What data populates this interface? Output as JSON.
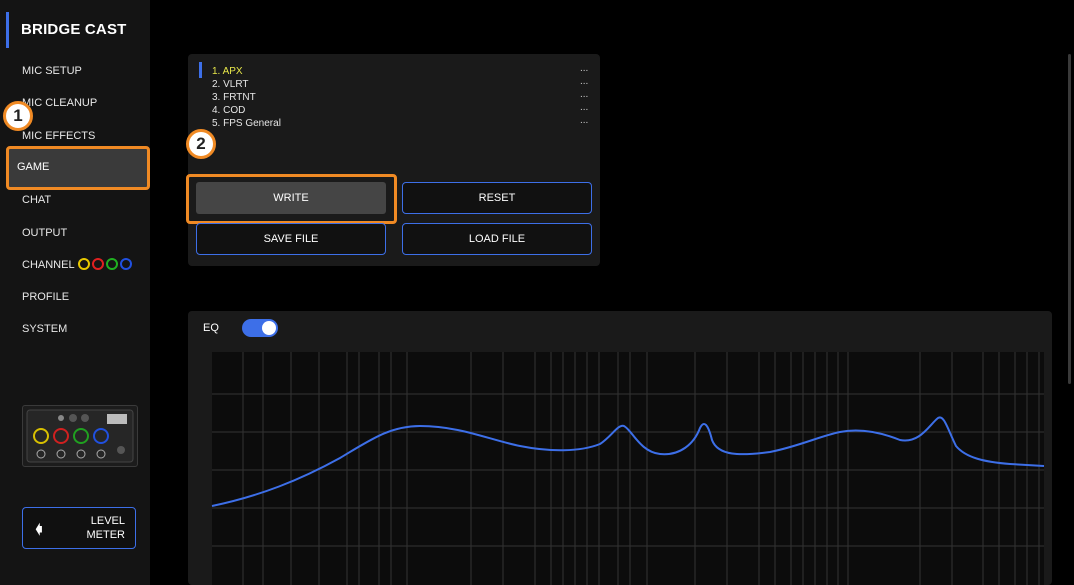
{
  "sidebar": {
    "brand": "BRIDGE CAST",
    "items": [
      {
        "label": "MIC SETUP"
      },
      {
        "label": "MIC CLEANUP"
      },
      {
        "label": "MIC EFFECTS"
      },
      {
        "label": "GAME"
      },
      {
        "label": "CHAT"
      },
      {
        "label": "OUTPUT"
      },
      {
        "label": "CHANNEL"
      },
      {
        "label": "PROFILE"
      },
      {
        "label": "SYSTEM"
      }
    ],
    "active_item": "GAME",
    "channel_ring_colors": [
      "#e8c800",
      "#e02020",
      "#20b020",
      "#2050e0"
    ],
    "level_meter": {
      "line1": "LEVEL",
      "line2": "METER",
      "icon": "arrow-left-icon"
    }
  },
  "callouts": {
    "one": "1",
    "two": "2"
  },
  "presets": {
    "items": [
      {
        "label": "1. APX",
        "menu": "..."
      },
      {
        "label": "2. VLRT",
        "menu": "..."
      },
      {
        "label": "3. FRTNT",
        "menu": "..."
      },
      {
        "label": "4. COD",
        "menu": "..."
      },
      {
        "label": "5. FPS General",
        "menu": "..."
      }
    ],
    "selected_index": 0
  },
  "buttons": {
    "write": "WRITE",
    "reset": "RESET",
    "save_file": "SAVE FILE",
    "load_file": "LOAD FILE"
  },
  "eq": {
    "label": "EQ",
    "enabled": true
  },
  "colors": {
    "accent": "#3d6fe8",
    "highlight": "#f08a24",
    "selected_text": "#e8e84a"
  }
}
